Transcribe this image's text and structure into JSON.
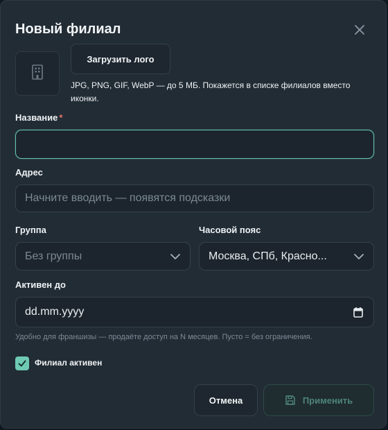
{
  "dialog": {
    "title": "Новый филиал",
    "close_icon": "close-icon"
  },
  "logo": {
    "placeholder_icon": "building-icon",
    "upload_label": "Загрузить лого",
    "hint": "JPG, PNG, GIF, WebP — до 5 МБ. Покажется в списке филиалов вместо иконки."
  },
  "name_field": {
    "label": "Название",
    "required_mark": "*",
    "value": ""
  },
  "address_field": {
    "label": "Адрес",
    "placeholder": "Начните вводить — появятся подсказки"
  },
  "group_field": {
    "label": "Группа",
    "selected": "Без группы"
  },
  "timezone_field": {
    "label": "Часовой пояс",
    "selected": "Москва, СПб, Красно..."
  },
  "active_until_field": {
    "label": "Активен до",
    "value": "dd.mm.yyyy",
    "helper": "Удобно для франшизы — продаёте доступ на N месяцев. Пусто = без ограничения."
  },
  "active_checkbox": {
    "label": "Филиал активен",
    "checked": true
  },
  "footer": {
    "cancel_label": "Отмена",
    "apply_label": "Применить",
    "apply_icon": "save-icon"
  },
  "colors": {
    "accent": "#6fcab4",
    "background": "#222c35",
    "required": "#e5736b"
  }
}
